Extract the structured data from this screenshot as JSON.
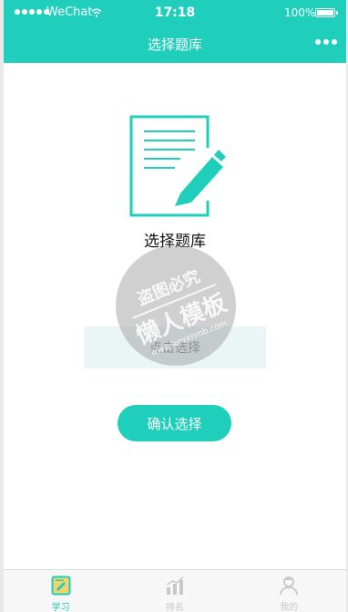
{
  "status_bar": {
    "carrier": "WeChat",
    "time": "17:18",
    "battery": "100%"
  },
  "nav": {
    "title": "选择题库"
  },
  "main": {
    "section_label": "选择题库",
    "select_placeholder": "点击选择",
    "confirm_button": "确认选择"
  },
  "watermark": {
    "line1": "盗图必究",
    "line2": "懒人模板",
    "url": "www.lanrenmb.com"
  },
  "tabbar": {
    "items": [
      {
        "label": "学习",
        "icon": "study-icon",
        "active": true
      },
      {
        "label": "排名",
        "icon": "ranking-icon",
        "active": false
      },
      {
        "label": "我的",
        "icon": "profile-icon",
        "active": false
      }
    ]
  },
  "colors": {
    "accent": "#1fcfbb",
    "field_bg": "#eaf6f5",
    "tab_inactive": "#c8c8c8"
  }
}
